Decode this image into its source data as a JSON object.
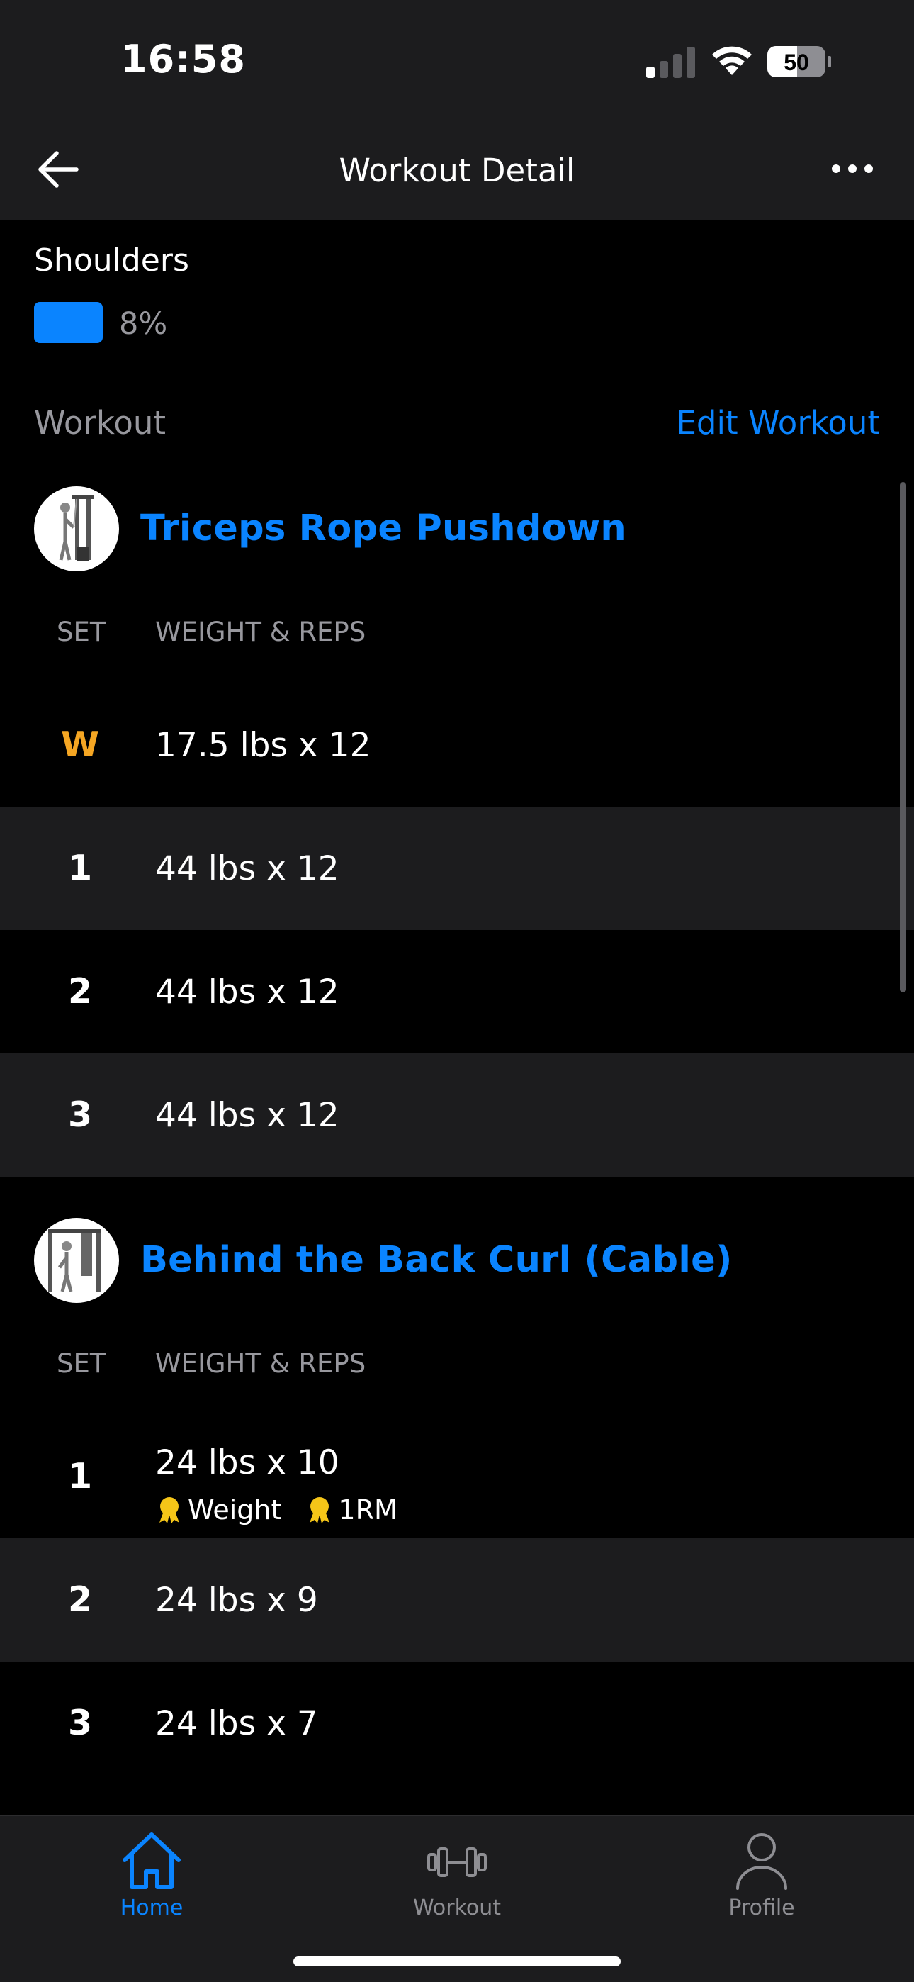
{
  "status": {
    "time": "16:58",
    "battery": "50"
  },
  "nav": {
    "title": "Workout Detail"
  },
  "muscle": {
    "name": "Shoulders",
    "percent": "8%",
    "bar_color": "#0a84ff"
  },
  "workout_section": {
    "label": "Workout",
    "edit_label": "Edit Workout"
  },
  "exercises": [
    {
      "title": "Triceps Rope Pushdown",
      "col_set": "SET",
      "col_weight_reps": "WEIGHT & REPS",
      "sets": [
        {
          "set": "W",
          "value": "17.5 lbs x 12"
        },
        {
          "set": "1",
          "value": "44 lbs x 12"
        },
        {
          "set": "2",
          "value": "44 lbs x 12"
        },
        {
          "set": "3",
          "value": "44 lbs x 12"
        }
      ]
    },
    {
      "title": "Behind the Back Curl (Cable)",
      "col_set": "SET",
      "col_weight_reps": "WEIGHT & REPS",
      "sets": [
        {
          "set": "1",
          "value": "24 lbs x 10",
          "badges": [
            "Weight",
            "1RM"
          ]
        },
        {
          "set": "2",
          "value": "24 lbs x 9"
        },
        {
          "set": "3",
          "value": "24 lbs x 7"
        }
      ]
    }
  ],
  "tabs": [
    {
      "label": "Home",
      "icon": "home-icon",
      "active": true
    },
    {
      "label": "Workout",
      "icon": "dumbbell-icon",
      "active": false
    },
    {
      "label": "Profile",
      "icon": "person-icon",
      "active": false
    }
  ],
  "colors": {
    "accent": "#0a84ff",
    "warmup": "#f5a623",
    "medal": "#f5c518"
  }
}
